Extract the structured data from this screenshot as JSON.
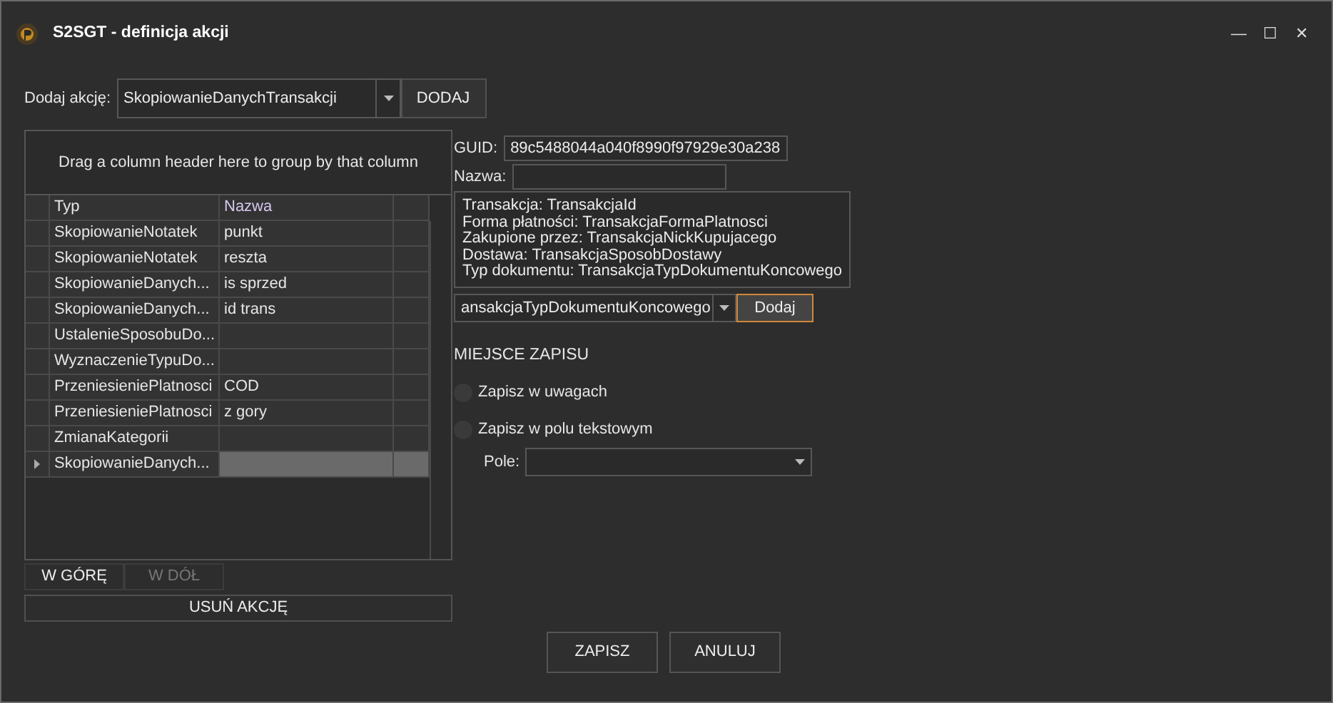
{
  "window": {
    "title": "S2SGT - definicja akcji",
    "controls": [
      "—",
      "☐",
      "✕"
    ]
  },
  "add_action": {
    "label": "Dodaj akcję:",
    "value": "SkopiowanieDanychTransakcji",
    "button": "DODAJ"
  },
  "grid": {
    "group_hint": "Drag a column header here to group by that column",
    "columns": [
      "Typ",
      "Nazwa"
    ],
    "rows": [
      {
        "typ": "SkopiowanieNotatek",
        "nazwa": "punkt",
        "selected": false
      },
      {
        "typ": "SkopiowanieNotatek",
        "nazwa": "reszta",
        "selected": false
      },
      {
        "typ": "SkopiowanieDanych...",
        "nazwa": "is sprzed",
        "selected": false
      },
      {
        "typ": "SkopiowanieDanych...",
        "nazwa": "id trans",
        "selected": false
      },
      {
        "typ": "UstalenieSposobuDo...",
        "nazwa": "",
        "selected": false
      },
      {
        "typ": "WyznaczenieTypuDo...",
        "nazwa": "",
        "selected": false
      },
      {
        "typ": "PrzeniesieniePlatnosci",
        "nazwa": "COD",
        "selected": false
      },
      {
        "typ": "PrzeniesieniePlatnosci",
        "nazwa": "z gory",
        "selected": false
      },
      {
        "typ": "ZmianaKategorii",
        "nazwa": "",
        "selected": false
      },
      {
        "typ": "SkopiowanieDanych...",
        "nazwa": "",
        "selected": true
      }
    ]
  },
  "move_buttons": [
    {
      "label": "W GÓRĘ",
      "disabled": false
    },
    {
      "label": "W DÓŁ",
      "disabled": true
    }
  ],
  "remove_button": "USUŃ AKCJĘ",
  "guid": {
    "label": "GUID:",
    "value": "89c5488044a040f8990f97929e30a238"
  },
  "name": {
    "label": "Nazwa:"
  },
  "mapping_lines": [
    "Transakcja: TransakcjaId",
    "Forma płatności: TransakcjaFormaPlatnosci",
    "Zakupione przez: TransakcjaNickKupujacego",
    "Dostawa: TransakcjaSposobDostawy",
    "Typ dokumentu: TransakcjaTypDokumentuKoncowego"
  ],
  "field_select": {
    "value": "ansakcjaTypDokumentuKoncowego",
    "button": "Dodaj"
  },
  "save_location": {
    "title": "MIEJSCE ZAPISU",
    "options": [
      {
        "label": "Zapisz w uwagach",
        "selected": false
      },
      {
        "label": "Zapisz w polu tekstowym",
        "selected": false
      }
    ],
    "field_label": "Pole:"
  },
  "footer_buttons": [
    "ZAPISZ",
    "ANULUJ"
  ]
}
